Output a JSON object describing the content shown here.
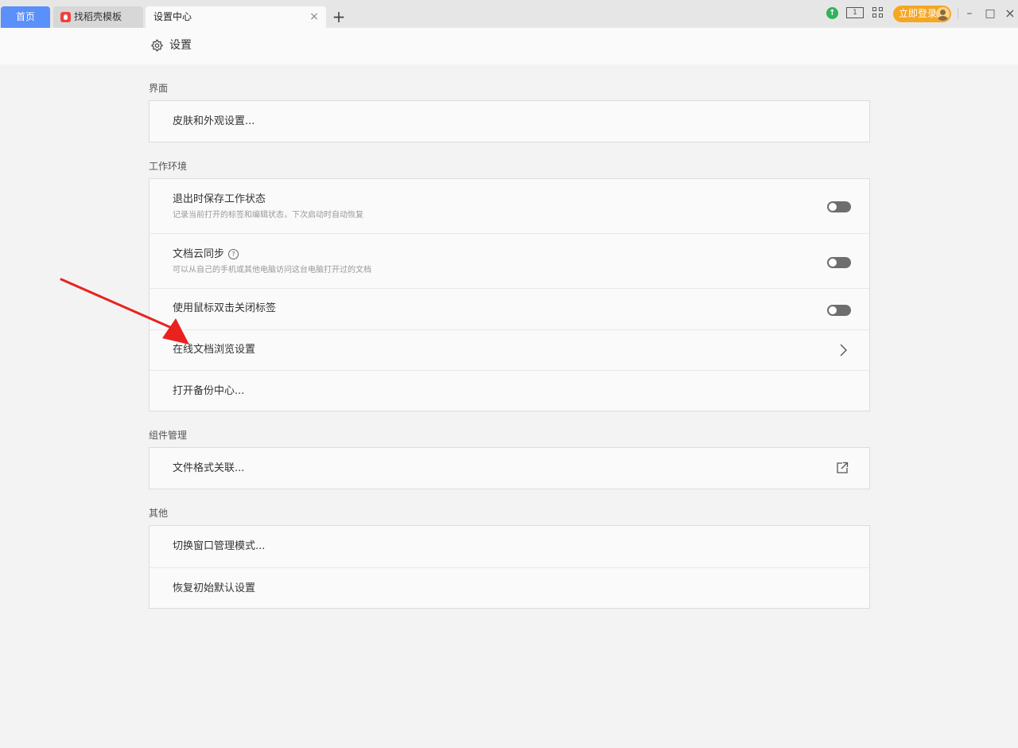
{
  "tabs": {
    "home": "首页",
    "template": "找稻壳模板",
    "settings": "设置中心",
    "close": "×",
    "add": "+"
  },
  "toolbar": {
    "update_icon": "upload-arrow-icon",
    "reading_mode_text": "1",
    "login_label": "立即登录",
    "minimize": "–",
    "maximize": "□",
    "close": "×"
  },
  "header": {
    "title": "设置"
  },
  "sections": {
    "interface": {
      "title": "界面",
      "skin": "皮肤和外观设置..."
    },
    "workspace": {
      "title": "工作环境",
      "save_state": "退出时保存工作状态",
      "save_state_desc": "记录当前打开的标签和编辑状态，下次启动时自动恢复",
      "cloud_sync": "文档云同步",
      "cloud_sync_desc": "可以从自己的手机或其他电脑访问这台电脑打开过的文档",
      "help_glyph": "?",
      "double_click_close": "使用鼠标双击关闭标签",
      "online_browse": "在线文档浏览设置",
      "backup_center": "打开备份中心..."
    },
    "components": {
      "title": "组件管理",
      "file_assoc": "文件格式关联..."
    },
    "other": {
      "title": "其他",
      "window_mode": "切换窗口管理模式...",
      "restore_defaults": "恢复初始默认设置"
    }
  },
  "toggles": {
    "save_state": false,
    "cloud_sync": false,
    "double_click_close": false
  },
  "colors": {
    "home_tab": "#5b8ff9",
    "login_button": "#f5a623",
    "update_icon": "#2fb459",
    "annotation_arrow": "#e8231f"
  }
}
